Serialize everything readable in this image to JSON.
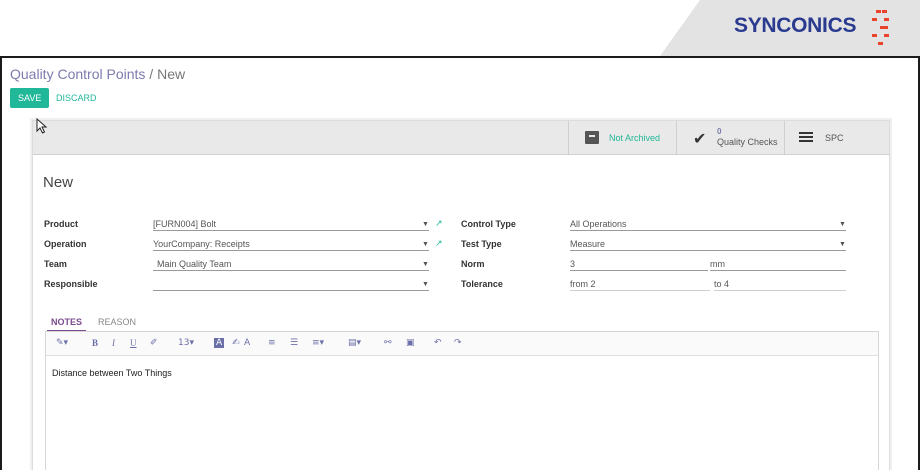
{
  "brand": {
    "name": "SYNCONICS"
  },
  "breadcrumb": {
    "parent": "Quality Control Points",
    "separator": "/",
    "current": "New"
  },
  "actions": {
    "save": "SAVE",
    "discard": "DISCARD"
  },
  "stat_buttons": {
    "archived": {
      "label": "Not Archived",
      "icon": "archive-icon"
    },
    "checks": {
      "count": "0",
      "label": "Quality Checks",
      "icon": "check-icon"
    },
    "spc": {
      "label": "SPC",
      "icon": "bars-icon"
    }
  },
  "form": {
    "title": "New",
    "product": {
      "label": "Product",
      "value": "[FURN004] Bolt"
    },
    "operation": {
      "label": "Operation",
      "value": "YourCompany: Receipts"
    },
    "team": {
      "label": "Team",
      "value": "Main Quality Team"
    },
    "responsible": {
      "label": "Responsible",
      "value": ""
    },
    "control_type": {
      "label": "Control Type",
      "value": "All Operations"
    },
    "test_type": {
      "label": "Test Type",
      "value": "Measure"
    },
    "norm": {
      "label": "Norm",
      "value": "3",
      "unit": "mm"
    },
    "tolerance": {
      "label": "Tolerance",
      "from": "from 2",
      "to": "to 4"
    }
  },
  "tabs": {
    "notes": "NOTES",
    "reason": "REASON"
  },
  "toolbar": {
    "style": "✎▾",
    "bold": "B",
    "italic": "I",
    "underline": "U",
    "eraser": "✐",
    "font_size": "13▾",
    "color": "A",
    "highlight": "✍",
    "text_color": "A",
    "ul": "≡",
    "ol": "☰",
    "align": "≡▾",
    "table": "▤▾",
    "link": "⚯",
    "picture": "▣",
    "undo": "↶",
    "redo": "↷"
  },
  "editor": {
    "content": "Distance between Two Things"
  }
}
